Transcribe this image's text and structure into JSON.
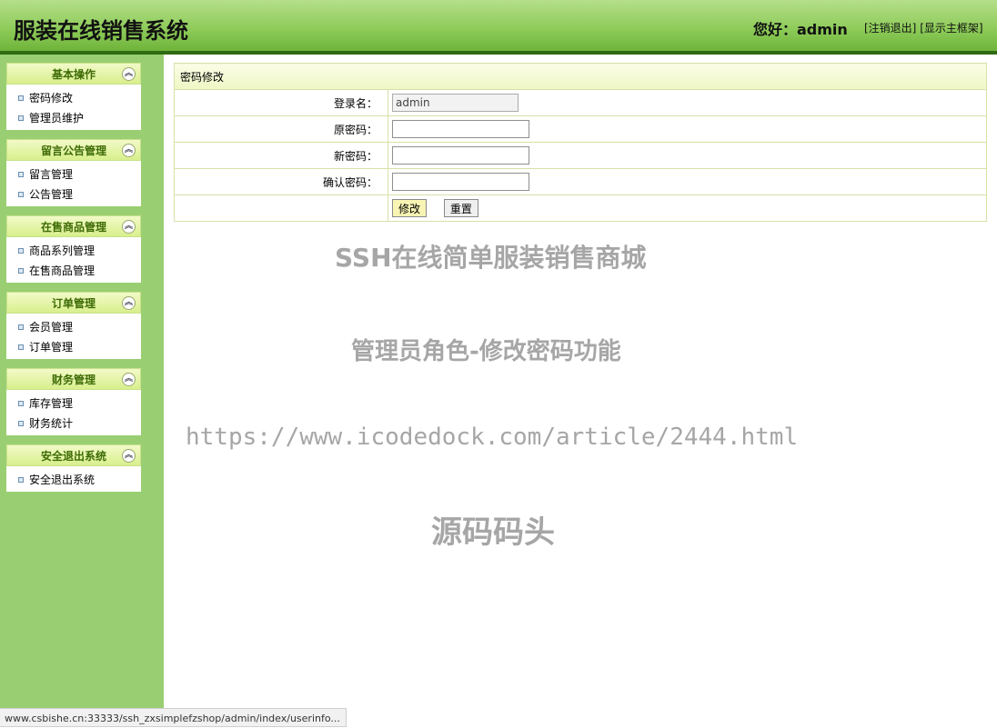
{
  "header": {
    "title": "服装在线销售系统",
    "greeting": "您好：admin",
    "logout_link": "[注销退出]",
    "show_frame_link": "[显示主框架]"
  },
  "sidebar": {
    "panels": [
      {
        "title": "基本操作",
        "items": [
          "密码修改",
          "管理员维护"
        ]
      },
      {
        "title": "留言公告管理",
        "items": [
          "留言管理",
          "公告管理"
        ]
      },
      {
        "title": "在售商品管理",
        "items": [
          "商品系列管理",
          "在售商品管理"
        ]
      },
      {
        "title": "订单管理",
        "items": [
          "会员管理",
          "订单管理"
        ]
      },
      {
        "title": "财务管理",
        "items": [
          "库存管理",
          "财务统计"
        ]
      },
      {
        "title": "安全退出系统",
        "items": [
          "安全退出系统"
        ]
      }
    ],
    "collapse_glyph": "︽"
  },
  "form": {
    "title": "密码修改",
    "login_label": "登录名：",
    "login_value": "admin",
    "old_pwd_label": "原密码：",
    "new_pwd_label": "新密码：",
    "confirm_pwd_label": "确认密码：",
    "submit_label": "修改",
    "reset_label": "重置"
  },
  "watermark": {
    "line1": "SSH在线简单服装销售商城",
    "line2": "管理员角色-修改密码功能",
    "line3": "https://www.icodedock.com/article/2444.html",
    "line4": "源码码头"
  },
  "statusbar": {
    "url": "www.csbishe.cn:33333/ssh_zxsimplefzshop/admin/index/userinfo..."
  },
  "colors": {
    "header_green": "#8fcc5b",
    "header_border": "#2e6b12",
    "sidebar_bg": "#99cf72",
    "panel_title": "#3e6b06",
    "table_border": "#d6e1a8"
  }
}
